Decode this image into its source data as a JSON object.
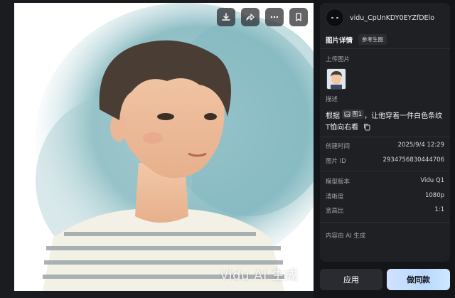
{
  "image": {
    "watermark": "Vidu AI 生成",
    "actions": [
      {
        "icon": "download-icon"
      },
      {
        "icon": "share-icon"
      },
      {
        "icon": "more-icon"
      },
      {
        "icon": "bookmark-icon"
      }
    ]
  },
  "panel": {
    "username": "vidu_CpUnKDY0EYZfDElo",
    "tabs": {
      "active": "图片详情",
      "secondary": "参考生图"
    },
    "upload_label": "上传图片",
    "desc_label": "描述",
    "description": {
      "prefix": "根据",
      "ref_chip": "图1",
      "suffix": "，让他穿着一件白色条纹T恤向右看"
    },
    "info": [
      {
        "label": "创建时间",
        "value": "2025/9/4 12:29"
      },
      {
        "label": "图片 ID",
        "value": "2934756830444706"
      }
    ],
    "params": [
      {
        "label": "模型版本",
        "value": "Vidu Q1"
      },
      {
        "label": "清晰度",
        "value": "1080p"
      },
      {
        "label": "宽高比",
        "value": "1:1"
      }
    ],
    "footer_note": "内容由 AI 生成"
  },
  "buttons": {
    "apply": "应用",
    "make_same": "做同款"
  },
  "colors": {
    "background": "#141518",
    "panel": "#1f2024",
    "accent_gradient_start": "#cfe3ff",
    "accent_gradient_end": "#cde8ff"
  }
}
